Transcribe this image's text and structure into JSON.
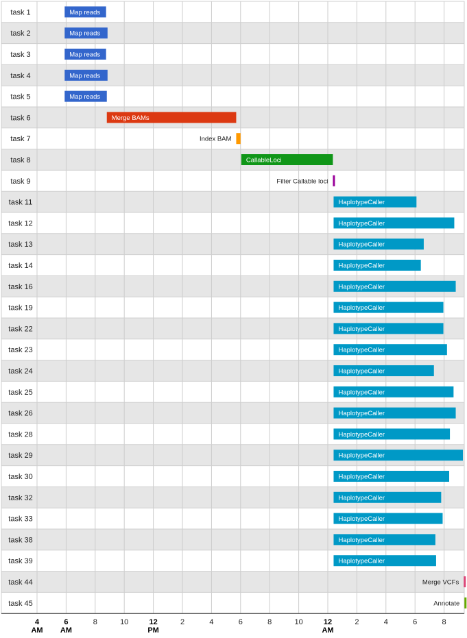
{
  "chart_data": {
    "type": "timeline",
    "x_unit": "hours",
    "x_range": [
      3,
      22.75
    ],
    "tick_labels": [
      {
        "t": 4,
        "line1": "4",
        "line2": "AM",
        "major": true
      },
      {
        "t": 6,
        "line1": "6",
        "line2": "AM",
        "major": true
      },
      {
        "t": 8,
        "line1": "8",
        "line2": "",
        "major": false
      },
      {
        "t": 10,
        "line1": "10",
        "line2": "",
        "major": false
      },
      {
        "t": 12,
        "line1": "12",
        "line2": "PM",
        "major": true
      },
      {
        "t": 14,
        "line1": "2",
        "line2": "",
        "major": false
      },
      {
        "t": 16,
        "line1": "4",
        "line2": "",
        "major": false
      },
      {
        "t": 18,
        "line1": "6",
        "line2": "",
        "major": false
      },
      {
        "t": 20,
        "line1": "8",
        "line2": "",
        "major": false
      },
      {
        "t": 22,
        "line1": "10",
        "line2": "",
        "major": false
      },
      {
        "t": 24,
        "line1": "12",
        "line2": "AM",
        "major": true
      },
      {
        "t": 26,
        "line1": "2",
        "line2": "",
        "major": false
      },
      {
        "t": 28,
        "line1": "4",
        "line2": "",
        "major": false
      },
      {
        "t": 30,
        "line1": "6",
        "line2": "",
        "major": false
      },
      {
        "t": 32,
        "line1": "8",
        "line2": "",
        "major": false
      }
    ],
    "rows": [
      {
        "task": "task 1",
        "bar": "Map reads",
        "start": 5.9,
        "end": 8.75,
        "color": "#3366cc",
        "label_inside": true
      },
      {
        "task": "task 2",
        "bar": "Map reads",
        "start": 5.9,
        "end": 8.85,
        "color": "#3366cc",
        "label_inside": true
      },
      {
        "task": "task 3",
        "bar": "Map reads",
        "start": 5.9,
        "end": 8.75,
        "color": "#3366cc",
        "label_inside": true
      },
      {
        "task": "task 4",
        "bar": "Map reads",
        "start": 5.9,
        "end": 8.85,
        "color": "#3366cc",
        "label_inside": true
      },
      {
        "task": "task 5",
        "bar": "Map reads",
        "start": 5.9,
        "end": 8.8,
        "color": "#3366cc",
        "label_inside": true
      },
      {
        "task": "task 6",
        "bar": "Merge BAMs",
        "start": 8.8,
        "end": 17.7,
        "color": "#dc3912",
        "label_inside": true
      },
      {
        "task": "task 7",
        "bar": "Index BAM",
        "start": 17.7,
        "end": 18.0,
        "color": "#ff9900",
        "label_inside": false
      },
      {
        "task": "task 8",
        "bar": "CallableLoci",
        "start": 18.05,
        "end": 24.35,
        "color": "#109618",
        "label_inside": true
      },
      {
        "task": "task 9",
        "bar": "Filter Callable loci",
        "start": 24.35,
        "end": 24.45,
        "color": "#990099",
        "label_inside": false
      },
      {
        "task": "task 11",
        "bar": "HaplotypeCaller",
        "start": 24.4,
        "end": 30.1,
        "color": "#0099c6",
        "label_inside": true
      },
      {
        "task": "task 12",
        "bar": "HaplotypeCaller",
        "start": 24.4,
        "end": 32.7,
        "color": "#0099c6",
        "label_inside": true
      },
      {
        "task": "task 13",
        "bar": "HaplotypeCaller",
        "start": 24.4,
        "end": 30.6,
        "color": "#0099c6",
        "label_inside": true
      },
      {
        "task": "task 14",
        "bar": "HaplotypeCaller",
        "start": 24.4,
        "end": 30.4,
        "color": "#0099c6",
        "label_inside": true
      },
      {
        "task": "task 16",
        "bar": "HaplotypeCaller",
        "start": 24.4,
        "end": 32.8,
        "color": "#0099c6",
        "label_inside": true
      },
      {
        "task": "task 19",
        "bar": "HaplotypeCaller",
        "start": 24.4,
        "end": 31.95,
        "color": "#0099c6",
        "label_inside": true
      },
      {
        "task": "task 22",
        "bar": "HaplotypeCaller",
        "start": 24.4,
        "end": 31.95,
        "color": "#0099c6",
        "label_inside": true
      },
      {
        "task": "task 23",
        "bar": "HaplotypeCaller",
        "start": 24.4,
        "end": 32.2,
        "color": "#0099c6",
        "label_inside": true
      },
      {
        "task": "task 24",
        "bar": "HaplotypeCaller",
        "start": 24.4,
        "end": 31.3,
        "color": "#0099c6",
        "label_inside": true
      },
      {
        "task": "task 25",
        "bar": "HaplotypeCaller",
        "start": 24.4,
        "end": 32.65,
        "color": "#0099c6",
        "label_inside": true
      },
      {
        "task": "task 26",
        "bar": "HaplotypeCaller",
        "start": 24.4,
        "end": 32.8,
        "color": "#0099c6",
        "label_inside": true
      },
      {
        "task": "task 28",
        "bar": "HaplotypeCaller",
        "start": 24.4,
        "end": 32.4,
        "color": "#0099c6",
        "label_inside": true
      },
      {
        "task": "task 29",
        "bar": "HaplotypeCaller",
        "start": 24.4,
        "end": 33.35,
        "color": "#0099c6",
        "label_inside": true
      },
      {
        "task": "task 30",
        "bar": "HaplotypeCaller",
        "start": 24.4,
        "end": 32.35,
        "color": "#0099c6",
        "label_inside": true
      },
      {
        "task": "task 32",
        "bar": "HaplotypeCaller",
        "start": 24.4,
        "end": 31.8,
        "color": "#0099c6",
        "label_inside": true
      },
      {
        "task": "task 33",
        "bar": "HaplotypeCaller",
        "start": 24.4,
        "end": 31.9,
        "color": "#0099c6",
        "label_inside": true
      },
      {
        "task": "task 38",
        "bar": "HaplotypeCaller",
        "start": 24.4,
        "end": 31.4,
        "color": "#0099c6",
        "label_inside": true
      },
      {
        "task": "task 39",
        "bar": "HaplotypeCaller",
        "start": 24.4,
        "end": 31.45,
        "color": "#0099c6",
        "label_inside": true
      },
      {
        "task": "task 44",
        "bar": "Merge VCFs",
        "start": 33.35,
        "end": 33.45,
        "color": "#dd4477",
        "label_inside": false
      },
      {
        "task": "task 45",
        "bar": "Annotate",
        "start": 33.4,
        "end": 33.5,
        "color": "#66aa00",
        "label_inside": false
      }
    ]
  }
}
